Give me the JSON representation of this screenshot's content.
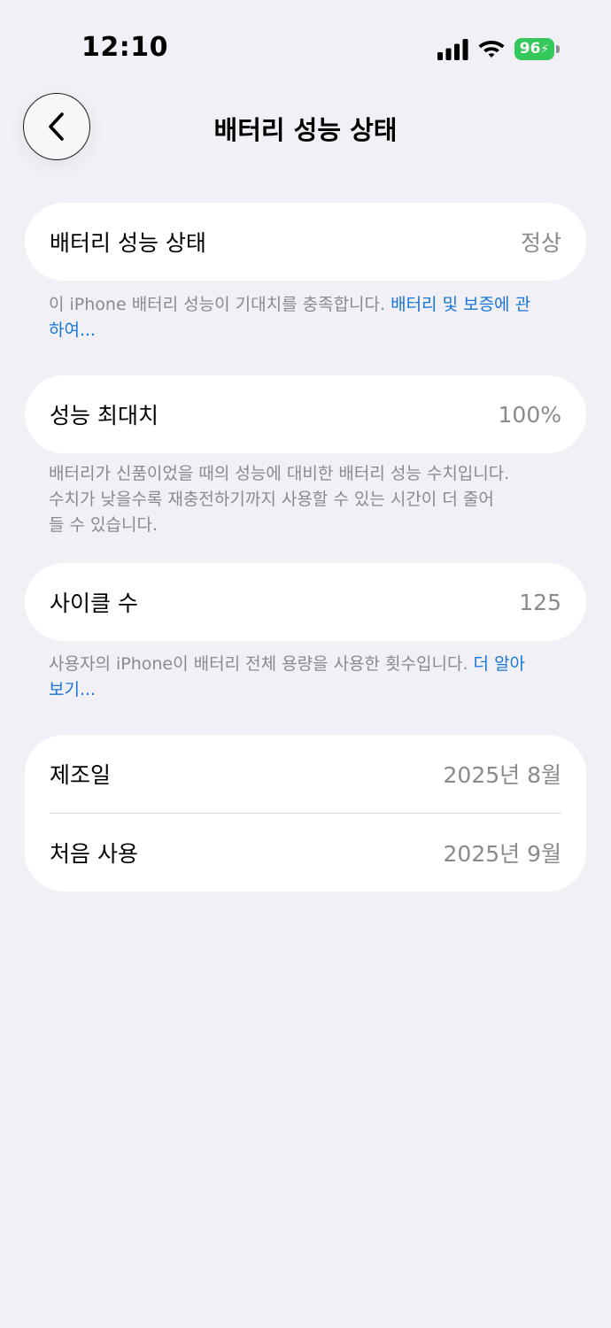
{
  "status_bar": {
    "time": "12:10",
    "battery_level": "96",
    "icons": [
      "signal-icon",
      "wifi-icon",
      "battery-charging-icon"
    ]
  },
  "nav": {
    "back_icon": "chevron-left-icon",
    "title": "배터리 성능 상태"
  },
  "sections": {
    "health": {
      "label": "배터리 성능 상태",
      "value": "정상",
      "note": "이 iPhone 배터리 성능이 기대치를 충족합니다. ",
      "link": "배터리 및 보증에 관하여..."
    },
    "max_capacity": {
      "label": "성능 최대치",
      "value": "100%",
      "note_line1": "배터리가 신품이었을 때의 성능에 대비한 배터리 성능 수치입니다.",
      "note_line2": "수치가 낮을수록 재충전하기까지 사용할 수 있는 시간이 더 줄어",
      "note_line3": "들 수 있습니다."
    },
    "cycle_count": {
      "label": "사이클 수",
      "value": "125",
      "note": "사용자의 iPhone이 배터리 전체 용량을 사용한 횟수입니다. ",
      "link": "더 알아보기..."
    },
    "dates": {
      "manufacture_label": "제조일",
      "manufacture_value": "2025년 8월",
      "first_use_label": "처음 사용",
      "first_use_value": "2025년 9월"
    }
  },
  "colors": {
    "background": "#F1F0F6",
    "card": "#FFFFFF",
    "secondary_text": "#8A8A8E",
    "link": "#1875D8",
    "battery_green": "#34C759"
  }
}
